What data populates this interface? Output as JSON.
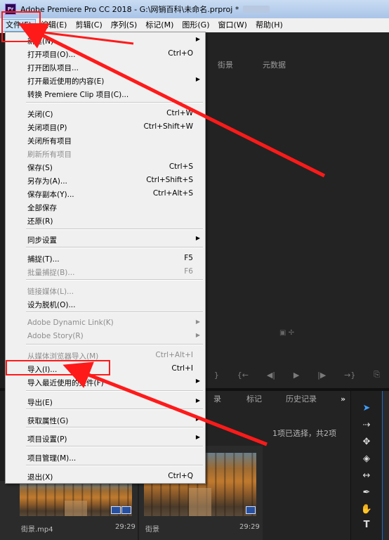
{
  "window": {
    "title": "Adobe Premiere Pro CC 2018 - G:\\网销百科\\未命名.prproj *",
    "app_icon": "Pr"
  },
  "menubar": {
    "items": [
      "文件(F)",
      "编辑(E)",
      "剪辑(C)",
      "序列(S)",
      "标记(M)",
      "图形(G)",
      "窗口(W)",
      "帮助(H)"
    ]
  },
  "panel": {
    "header_tab1": "街景",
    "header_tab2": "元数据"
  },
  "project_panel": {
    "tab_mark": "标记",
    "tab_history": "历史记录",
    "tab_more": "»",
    "tab_partial": "录",
    "selection_info": "1项已选择，共2项",
    "clips": [
      {
        "name": "街景.mp4",
        "duration": "29:29"
      },
      {
        "name": "街景",
        "duration": "29:29"
      }
    ]
  },
  "file_menu": {
    "items": [
      {
        "label": "新建(N)",
        "shortcut": "",
        "submenu": true,
        "disabled": false
      },
      {
        "label": "打开项目(O)...",
        "shortcut": "Ctrl+O",
        "submenu": false,
        "disabled": false
      },
      {
        "label": "打开团队项目...",
        "shortcut": "",
        "submenu": false,
        "disabled": false
      },
      {
        "label": "打开最近使用的内容(E)",
        "shortcut": "",
        "submenu": true,
        "disabled": false
      },
      {
        "label": "转换 Premiere Clip 项目(C)...",
        "shortcut": "",
        "submenu": false,
        "disabled": false
      },
      {
        "label": "关闭(C)",
        "shortcut": "Ctrl+W",
        "submenu": false,
        "disabled": false
      },
      {
        "label": "关闭项目(P)",
        "shortcut": "Ctrl+Shift+W",
        "submenu": false,
        "disabled": false
      },
      {
        "label": "关闭所有项目",
        "shortcut": "",
        "submenu": false,
        "disabled": false
      },
      {
        "label": "刷新所有项目",
        "shortcut": "",
        "submenu": false,
        "disabled": true
      },
      {
        "label": "保存(S)",
        "shortcut": "Ctrl+S",
        "submenu": false,
        "disabled": false
      },
      {
        "label": "另存为(A)...",
        "shortcut": "Ctrl+Shift+S",
        "submenu": false,
        "disabled": false
      },
      {
        "label": "保存副本(Y)...",
        "shortcut": "Ctrl+Alt+S",
        "submenu": false,
        "disabled": false
      },
      {
        "label": "全部保存",
        "shortcut": "",
        "submenu": false,
        "disabled": false
      },
      {
        "label": "还原(R)",
        "shortcut": "",
        "submenu": false,
        "disabled": false
      },
      {
        "label": "同步设置",
        "shortcut": "",
        "submenu": true,
        "disabled": false
      },
      {
        "label": "捕捉(T)...",
        "shortcut": "F5",
        "submenu": false,
        "disabled": false
      },
      {
        "label": "批量捕捉(B)...",
        "shortcut": "F6",
        "submenu": false,
        "disabled": true
      },
      {
        "label": "链接媒体(L)...",
        "shortcut": "",
        "submenu": false,
        "disabled": true
      },
      {
        "label": "设为脱机(O)...",
        "shortcut": "",
        "submenu": false,
        "disabled": false
      },
      {
        "label": "Adobe Dynamic Link(K)",
        "shortcut": "",
        "submenu": true,
        "disabled": true
      },
      {
        "label": "Adobe Story(R)",
        "shortcut": "",
        "submenu": true,
        "disabled": true
      },
      {
        "label": "从媒体浏览器导入(M)",
        "shortcut": "Ctrl+Alt+I",
        "submenu": false,
        "disabled": true
      },
      {
        "label": "导入(I)...",
        "shortcut": "Ctrl+I",
        "submenu": false,
        "disabled": false
      },
      {
        "label": "导入最近使用的文件(F)",
        "shortcut": "",
        "submenu": true,
        "disabled": false
      },
      {
        "label": "导出(E)",
        "shortcut": "",
        "submenu": true,
        "disabled": false
      },
      {
        "label": "获取属性(G)",
        "shortcut": "",
        "submenu": true,
        "disabled": false
      },
      {
        "label": "项目设置(P)",
        "shortcut": "",
        "submenu": true,
        "disabled": false
      },
      {
        "label": "项目管理(M)...",
        "shortcut": "",
        "submenu": false,
        "disabled": false
      },
      {
        "label": "退出(X)",
        "shortcut": "Ctrl+Q",
        "submenu": false,
        "disabled": false
      }
    ]
  },
  "colors": {
    "annotation_red": "#ff1a1a",
    "menu_highlight": "#cce4f7",
    "selected_tool": "#3ea0ff"
  }
}
